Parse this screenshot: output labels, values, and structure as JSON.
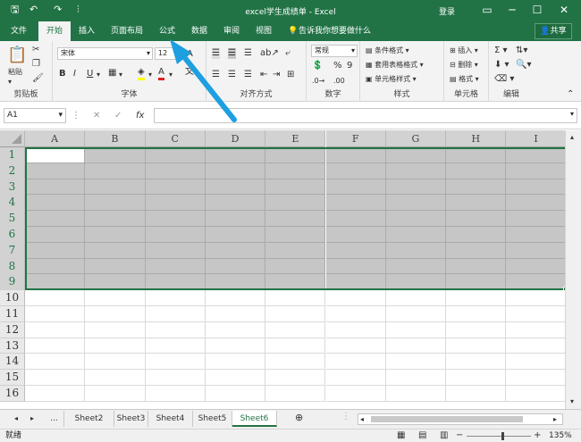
{
  "window": {
    "title": "excel学生成绩单 - Excel",
    "login": "登录",
    "qa_save": "🖫",
    "qa_undo": "↶",
    "qa_redo": "↷",
    "qa_more": "⫶",
    "ribbon_display": "▭",
    "minimize": "─",
    "maximize": "☐",
    "close": "✕"
  },
  "tabs": [
    "文件",
    "开始",
    "插入",
    "页面布局",
    "公式",
    "数据",
    "审阅",
    "视图"
  ],
  "tell_me": "告诉我你想要做什么",
  "share": "共享",
  "ribbon": {
    "clipboard": {
      "label": "剪贴板",
      "paste": "粘贴"
    },
    "font": {
      "label": "字体",
      "name": "宋体",
      "size": "12",
      "bold": "B",
      "italic": "I",
      "underline": "U",
      "color_a": "A"
    },
    "align": {
      "label": "对齐方式"
    },
    "number": {
      "label": "数字",
      "format": "常规",
      "percent": "%",
      "comma": "9"
    },
    "styles": {
      "label": "样式",
      "cond": "条件格式",
      "table": "套用表格格式",
      "cell": "单元格样式"
    },
    "cells": {
      "label": "单元格",
      "insert": "插入",
      "delete": "删除",
      "format": "格式"
    },
    "edit": {
      "label": "编辑"
    }
  },
  "namebox": "A1",
  "fx": "fx",
  "columns": [
    "A",
    "B",
    "C",
    "D",
    "E",
    "F",
    "G",
    "H",
    "I"
  ],
  "rows": [
    "1",
    "2",
    "3",
    "4",
    "5",
    "6",
    "7",
    "8",
    "9",
    "10",
    "11",
    "12",
    "13",
    "14",
    "15",
    "16"
  ],
  "selected_rows": 9,
  "sheets": [
    "Sheet2",
    "Sheet3",
    "Sheet4",
    "Sheet5",
    "Sheet6"
  ],
  "active_sheet": "Sheet6",
  "sheet_more": "...",
  "status": {
    "ready": "就绪",
    "zoom": "135%"
  },
  "colors": {
    "accent": "#217346",
    "selection": "#c6c6c6",
    "arrow": "#1e9fe0"
  }
}
